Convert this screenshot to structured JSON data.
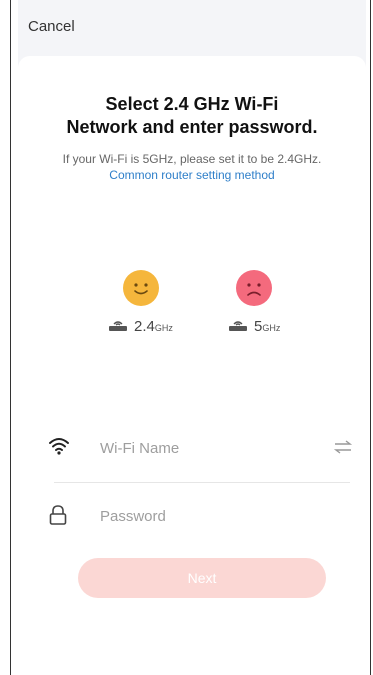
{
  "header": {
    "cancel_label": "Cancel"
  },
  "main": {
    "title_line1": "Select 2.4 GHz Wi-Fi",
    "title_line2": "Network and enter password.",
    "subtitle_text": "If your Wi-Fi is 5GHz, please set it to be 2.4GHz.",
    "subtitle_link": "Common router setting method",
    "bands": [
      {
        "value": "2.4",
        "unit": "GHz",
        "mood": "happy"
      },
      {
        "value": "5",
        "unit": "GHz",
        "mood": "sad"
      }
    ],
    "wifi_placeholder": "Wi-Fi Name",
    "password_placeholder": "Password",
    "next_label": "Next"
  },
  "icons": {
    "wifi": "wifi-icon",
    "lock": "lock-icon",
    "swap": "swap-icon",
    "router": "router-icon",
    "happy": "happy-face-icon",
    "sad": "sad-face-icon"
  },
  "colors": {
    "happy_face": "#f5b63c",
    "sad_face": "#f46a7d",
    "link": "#2f7fc9",
    "next_button_disabled": "#fbd7d4"
  }
}
